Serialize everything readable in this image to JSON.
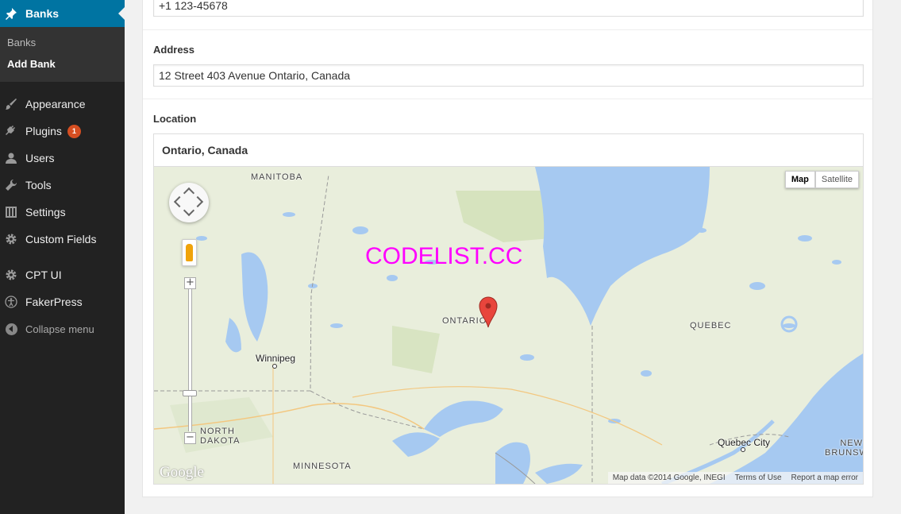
{
  "sidebar": {
    "active": {
      "label": "Banks",
      "icon": "pushpin-icon"
    },
    "submenu": [
      "Banks",
      "Add Bank"
    ],
    "items": [
      {
        "label": "Appearance",
        "icon": "paintbrush-icon"
      },
      {
        "label": "Plugins",
        "icon": "plug-icon",
        "badge": "1"
      },
      {
        "label": "Users",
        "icon": "user-icon"
      },
      {
        "label": "Tools",
        "icon": "wrench-icon"
      },
      {
        "label": "Settings",
        "icon": "settings-icon"
      },
      {
        "label": "Custom Fields",
        "icon": "gear-icon"
      },
      {
        "label": "CPT UI",
        "icon": "gear-icon"
      },
      {
        "label": "FakerPress",
        "icon": "accessibility-icon"
      }
    ],
    "collapse_label": "Collapse menu"
  },
  "form": {
    "phone_value": "+1 123-45678",
    "address_label": "Address",
    "address_value": "12 Street 403 Avenue Ontario, Canada",
    "location_label": "Location",
    "location_search": "Ontario, Canada"
  },
  "map": {
    "type_options": [
      "Map",
      "Satellite"
    ],
    "type_selected": "Map",
    "zoom_in": "+",
    "zoom_out": "−",
    "labels": {
      "manitoba": "MANITOBA",
      "ontario": "ONTARIO",
      "quebec": "QUEBEC",
      "north_dakota": "NORTH DAKOTA",
      "minnesota": "MINNESOTA",
      "new_brunswick": "NEW BRUNSWICK",
      "winnipeg": "Winnipeg",
      "quebec_city": "Quebec City"
    },
    "logo": "Google",
    "attribution": [
      "Map data ©2014 Google, INEGI",
      "Terms of Use",
      "Report a map error"
    ],
    "colors": {
      "land": "#e8eedb",
      "water": "#a4c8f0",
      "marker": "#e8453c"
    }
  },
  "watermark": "CODELIST.CC"
}
